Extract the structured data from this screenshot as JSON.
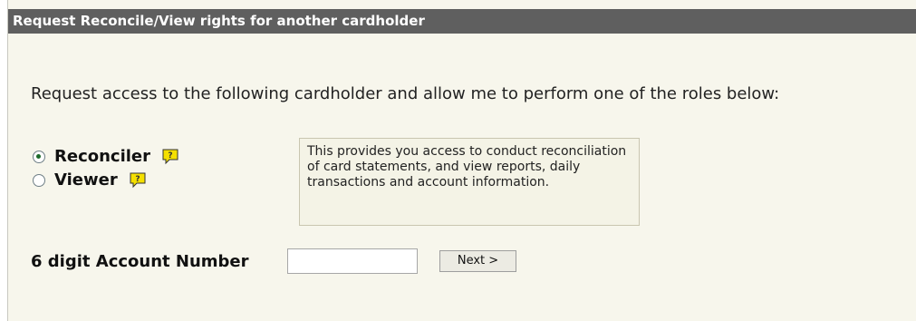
{
  "title": "Request Reconcile/View rights for another cardholder",
  "intro": "Request access to the following cardholder and allow me to perform one of the roles below:",
  "roles": [
    {
      "label": "Reconciler",
      "selected": true,
      "icon": "help-note-icon"
    },
    {
      "label": "Viewer",
      "selected": false,
      "icon": "help-note-icon"
    }
  ],
  "info_text": "This provides you access to conduct reconciliation of card statements, and view reports, daily transactions and account information.",
  "account": {
    "label": "6 digit Account Number",
    "value": "",
    "placeholder": ""
  },
  "next_label": "Next >",
  "colors": {
    "titlebar": "#5f5f5f",
    "panel_bg": "#f7f6ec",
    "help_icon_bg": "#f5e000"
  }
}
